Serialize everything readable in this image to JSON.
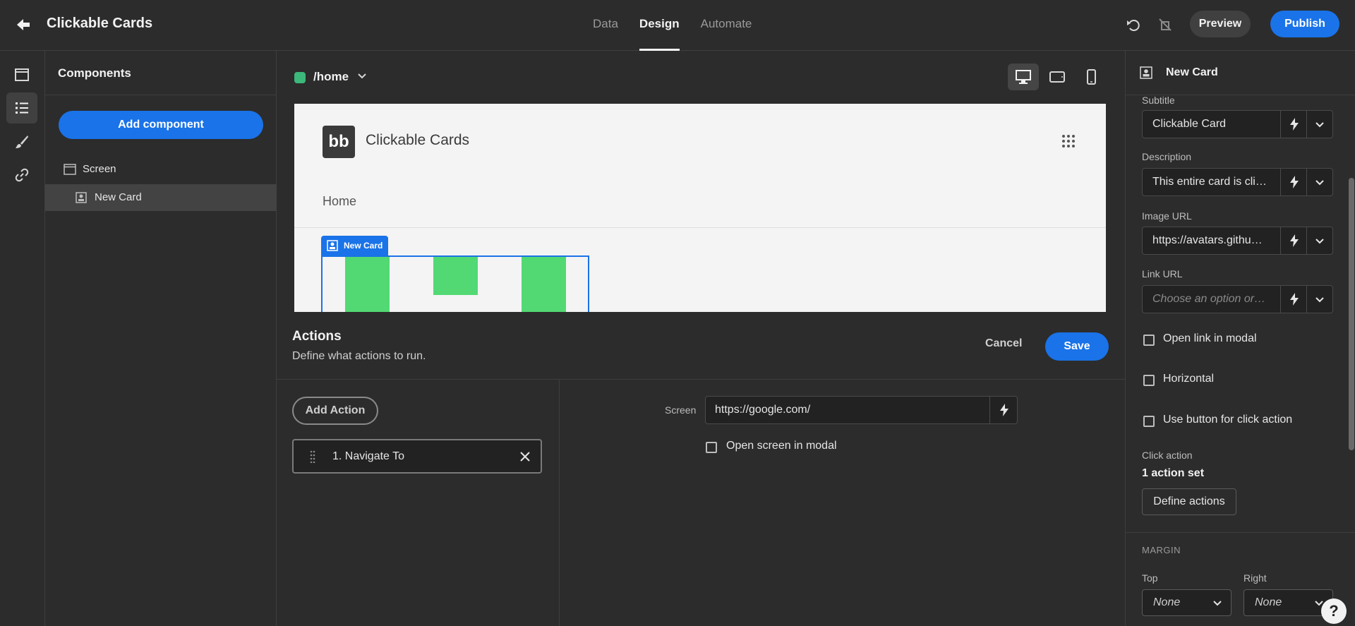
{
  "app": {
    "title": "Clickable Cards",
    "tabs": [
      {
        "label": "Data",
        "active": false
      },
      {
        "label": "Design",
        "active": true
      },
      {
        "label": "Automate",
        "active": false
      }
    ],
    "preview_label": "Preview",
    "publish_label": "Publish"
  },
  "components_panel": {
    "title": "Components",
    "add_button": "Add component",
    "tree": [
      {
        "label": "Screen",
        "icon": "screen-icon",
        "selected": false
      },
      {
        "label": "New Card",
        "icon": "card-icon",
        "selected": true
      }
    ]
  },
  "canvas": {
    "route": "/home",
    "route_color": "#3cb87a",
    "preview": {
      "logo_text": "bb",
      "app_title": "Clickable Cards",
      "nav_item": "Home",
      "selected_tag": "New Card"
    }
  },
  "actions": {
    "title": "Actions",
    "subtitle": "Define what actions to run.",
    "cancel_label": "Cancel",
    "save_label": "Save",
    "add_action_label": "Add Action",
    "items": [
      {
        "label": "1. Navigate To"
      }
    ],
    "screen_label": "Screen",
    "screen_value": "https://google.com/",
    "open_in_modal_label": "Open screen in modal"
  },
  "settings": {
    "component_name": "New Card",
    "fields": [
      {
        "label": "Subtitle",
        "value": "Clickable Card",
        "placeholder": false
      },
      {
        "label": "Description",
        "value": "This entire card is cli…",
        "placeholder": false
      },
      {
        "label": "Image URL",
        "value": "https://avatars.githu…",
        "placeholder": false
      },
      {
        "label": "Link URL",
        "value": "Choose an option or…",
        "placeholder": true
      }
    ],
    "checkboxes": [
      {
        "label": "Open link in modal",
        "checked": false
      },
      {
        "label": "Horizontal",
        "checked": false
      },
      {
        "label": "Use button for click action",
        "checked": false
      }
    ],
    "click_action_label": "Click action",
    "click_action_value": "1 action set",
    "define_actions_label": "Define actions",
    "margin_heading": "MARGIN",
    "margin": [
      {
        "label": "Top",
        "value": "None"
      },
      {
        "label": "Right",
        "value": "None"
      }
    ]
  },
  "help_label": "?",
  "colors": {
    "accent": "#1a73e8",
    "bar_green": "#52d973",
    "background": "#2c2c2c"
  }
}
